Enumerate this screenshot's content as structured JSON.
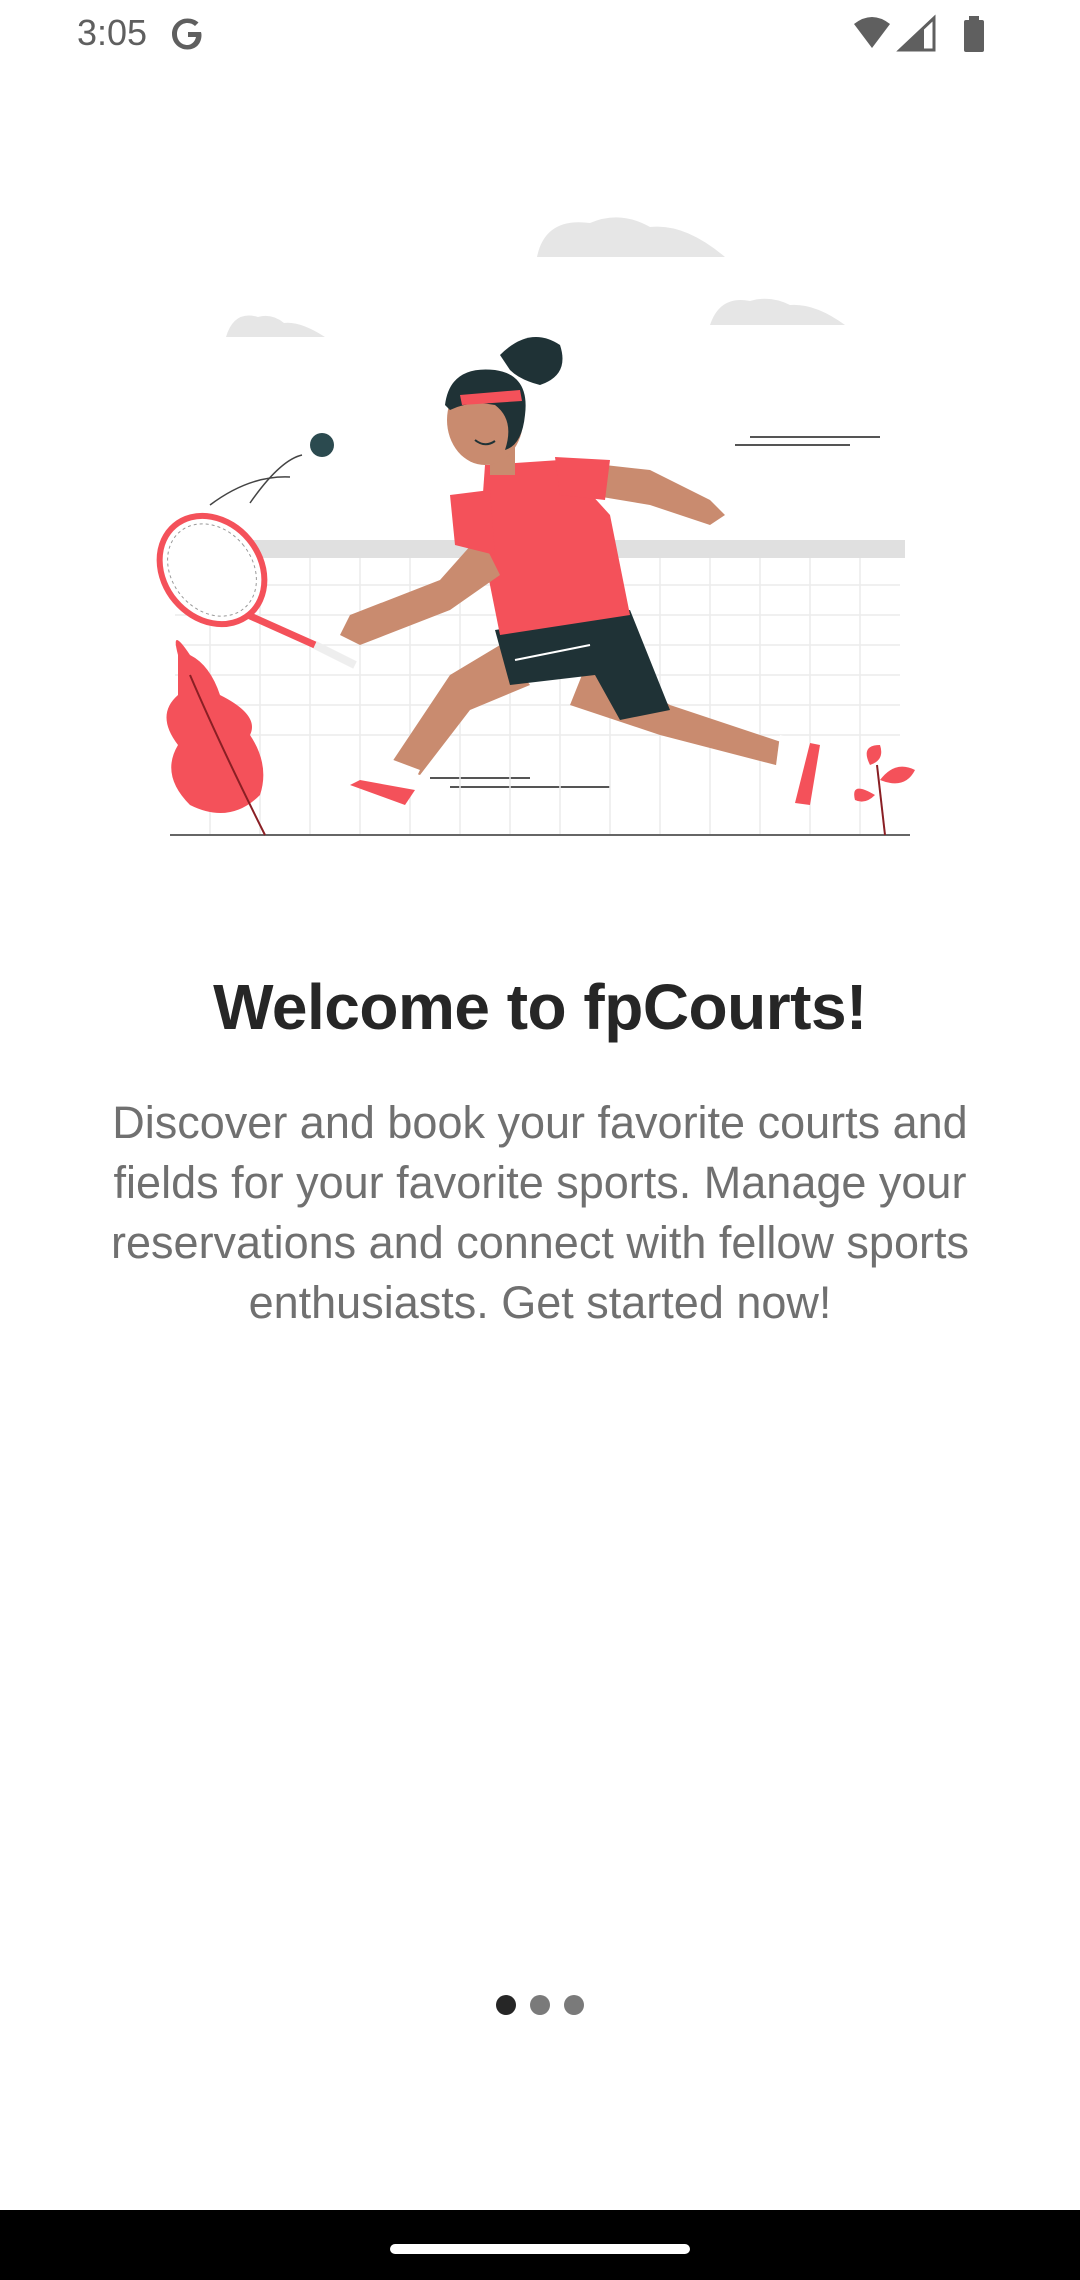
{
  "status_bar": {
    "time": "3:05",
    "google_icon": "google-g-icon",
    "icons": [
      "wifi-icon",
      "signal-icon",
      "battery-icon"
    ]
  },
  "onboarding": {
    "illustration": "tennis-player-illustration",
    "title": "Welcome to fpCourts!",
    "description": "Discover and book your favorite courts and fields for your favorite sports. Manage your reservations and connect with fellow sports enthusiasts. Get started now!",
    "page_count": 3,
    "current_page": 1
  },
  "colors": {
    "accent": "#f4515a",
    "skin": "#c98b6f",
    "dark": "#1f3236",
    "text_title": "#262626",
    "text_body": "#707070"
  }
}
